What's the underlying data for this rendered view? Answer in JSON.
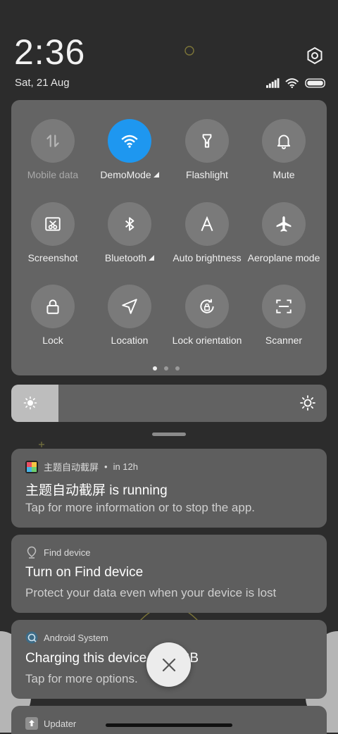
{
  "status": {
    "time": "2:36",
    "date": "Sat, 21 Aug",
    "icons": [
      "signal-icon",
      "wifi-icon",
      "battery-icon"
    ]
  },
  "quick_settings": {
    "tiles": [
      {
        "label": "Mobile data",
        "icon": "mobile-data-icon",
        "state": "disabled"
      },
      {
        "label": "DemoMode",
        "icon": "wifi-icon",
        "state": "active",
        "has_indicator": true
      },
      {
        "label": "Flashlight",
        "icon": "flashlight-icon",
        "state": "off"
      },
      {
        "label": "Mute",
        "icon": "bell-icon",
        "state": "off"
      },
      {
        "label": "Screenshot",
        "icon": "screenshot-icon",
        "state": "off"
      },
      {
        "label": "Bluetooth",
        "icon": "bluetooth-icon",
        "state": "off",
        "has_indicator": true
      },
      {
        "label": "Auto brightness",
        "icon": "auto-brightness-icon",
        "state": "off"
      },
      {
        "label": "Aeroplane mode",
        "icon": "airplane-icon",
        "state": "off"
      },
      {
        "label": "Lock",
        "icon": "lock-icon",
        "state": "off"
      },
      {
        "label": "Location",
        "icon": "location-icon",
        "state": "off"
      },
      {
        "label": "Lock orientation",
        "icon": "rotation-lock-icon",
        "state": "off"
      },
      {
        "label": "Scanner",
        "icon": "scanner-icon",
        "state": "off"
      }
    ],
    "page_count": 3,
    "current_page": 1
  },
  "brightness": {
    "level": 0.15
  },
  "notifications": [
    {
      "app": "主题自动截屏",
      "time": "in 12h",
      "title": "主题自动截屏 is running",
      "body": "Tap for more information or to stop the app.",
      "icon": "theme-app-icon"
    },
    {
      "app": "Find device",
      "time": "",
      "title": "Turn on Find device",
      "body": "Protect your data even when your device is lost",
      "icon": "location-pin-icon"
    },
    {
      "app": "Android System",
      "time": "",
      "title": "Charging this device via USB",
      "body": "Tap for more options.",
      "icon": "android-system-icon"
    },
    {
      "app": "Updater",
      "time": "",
      "title": "",
      "body": "",
      "icon": "updater-icon"
    }
  ],
  "colors": {
    "accent": "#1e97f0",
    "background": "#2c2c2c",
    "panel": "#646464",
    "card": "#5e5e5e"
  }
}
